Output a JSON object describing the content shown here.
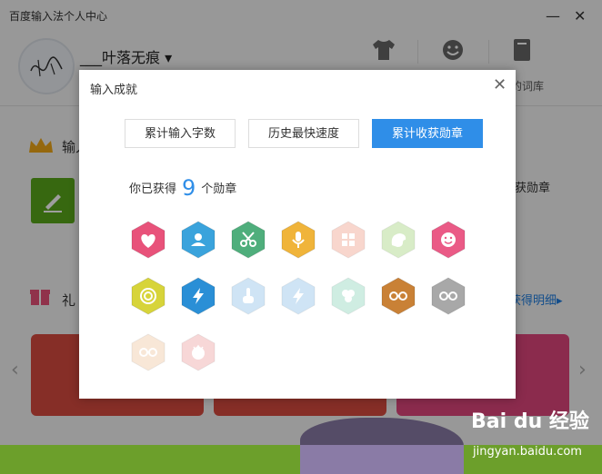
{
  "window": {
    "title": "百度输入法个人中心",
    "minimize": "—",
    "close": "✕"
  },
  "header": {
    "username": "___叶落无痕",
    "dropdown": "▾",
    "partial_label": "的词库"
  },
  "background": {
    "section1": "输入",
    "section2": "礼",
    "partial_badges": "获勋章",
    "link": "获得明细",
    "link_arrow": "▸",
    "arrows": [
      "‹",
      "›"
    ]
  },
  "dialog": {
    "title": "输入成就",
    "close": "✕",
    "tabs": [
      {
        "label": "累计输入字数",
        "active": false
      },
      {
        "label": "历史最快速度",
        "active": false
      },
      {
        "label": "累计收获勋章",
        "active": true
      }
    ],
    "summary_prefix": "你已获得",
    "count": "9",
    "summary_suffix": "个勋章",
    "badges": [
      {
        "name": "heart",
        "color": "#e8527a",
        "earned": true
      },
      {
        "name": "user",
        "color": "#3aa3dc",
        "earned": true
      },
      {
        "name": "scissors",
        "color": "#4fae7c",
        "earned": true
      },
      {
        "name": "microphone",
        "color": "#f0b43a",
        "earned": true
      },
      {
        "name": "grid",
        "color": "#f4b6a6",
        "earned": false
      },
      {
        "name": "palette",
        "color": "#b9dd9a",
        "earned": false
      },
      {
        "name": "smile",
        "color": "#ea5a86",
        "earned": true
      },
      {
        "name": "snail",
        "color": "#d7d43a",
        "earned": true
      },
      {
        "name": "lightning",
        "color": "#2a8fd6",
        "earned": true
      },
      {
        "name": "finger",
        "color": "#a8cfee",
        "earned": false
      },
      {
        "name": "lightning",
        "color": "#a8cfee",
        "earned": false
      },
      {
        "name": "clover",
        "color": "#a8e0cc",
        "earned": false
      },
      {
        "name": "glasses",
        "color": "#c98136",
        "earned": true
      },
      {
        "name": "glasses",
        "color": "#a8a8a8",
        "earned": true
      },
      {
        "name": "glasses",
        "color": "#f3d5b8",
        "earned": false
      },
      {
        "name": "face",
        "color": "#f2b7b7",
        "earned": false
      }
    ]
  },
  "watermark": {
    "logo": "Bai du 经验",
    "url": "jingyan.baidu.com"
  }
}
